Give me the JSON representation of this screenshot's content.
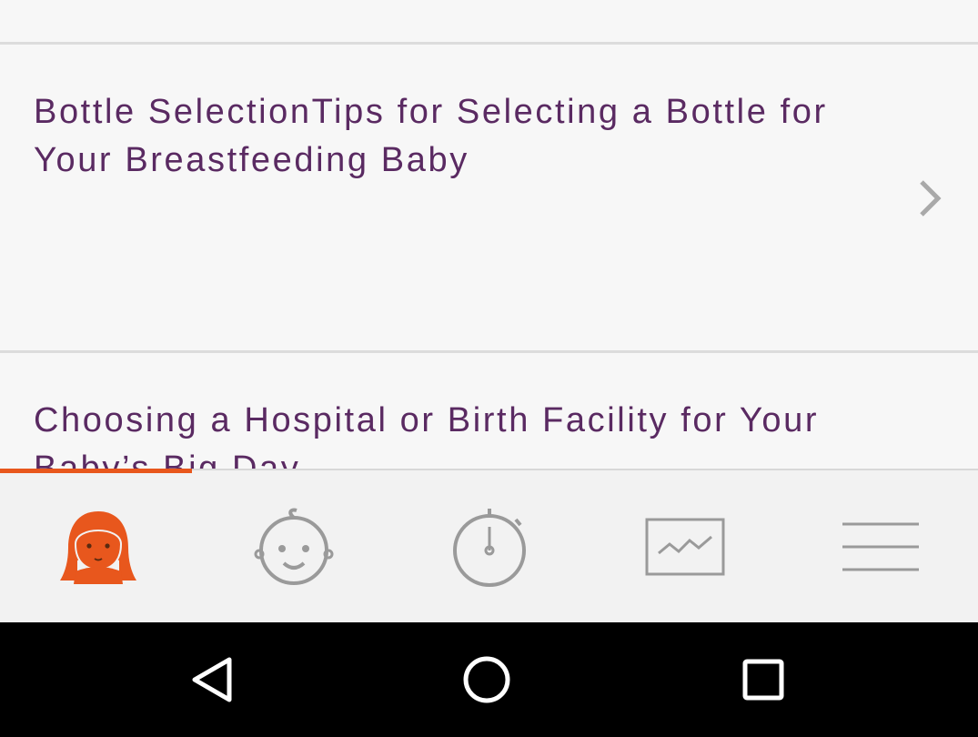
{
  "articles": [
    {
      "title": "Bottle SelectionTips for Selecting a Bottle for Your Breastfeeding Baby"
    },
    {
      "title": "Choosing a Hospital or Birth Facility for Your Baby’s Big Day"
    }
  ],
  "tabs": [
    {
      "icon": "mother-icon",
      "active": true
    },
    {
      "icon": "baby-face-icon",
      "active": false
    },
    {
      "icon": "stopwatch-icon",
      "active": false
    },
    {
      "icon": "chart-icon",
      "active": false
    },
    {
      "icon": "menu-icon",
      "active": false
    }
  ],
  "system_nav": [
    "back-icon",
    "home-icon",
    "recents-icon"
  ],
  "colors": {
    "accent": "#e8571d",
    "title_text": "#5a2a62",
    "tab_icon": "#9a9a9a",
    "background": "#f7f7f7",
    "nav_bar": "#000000"
  }
}
